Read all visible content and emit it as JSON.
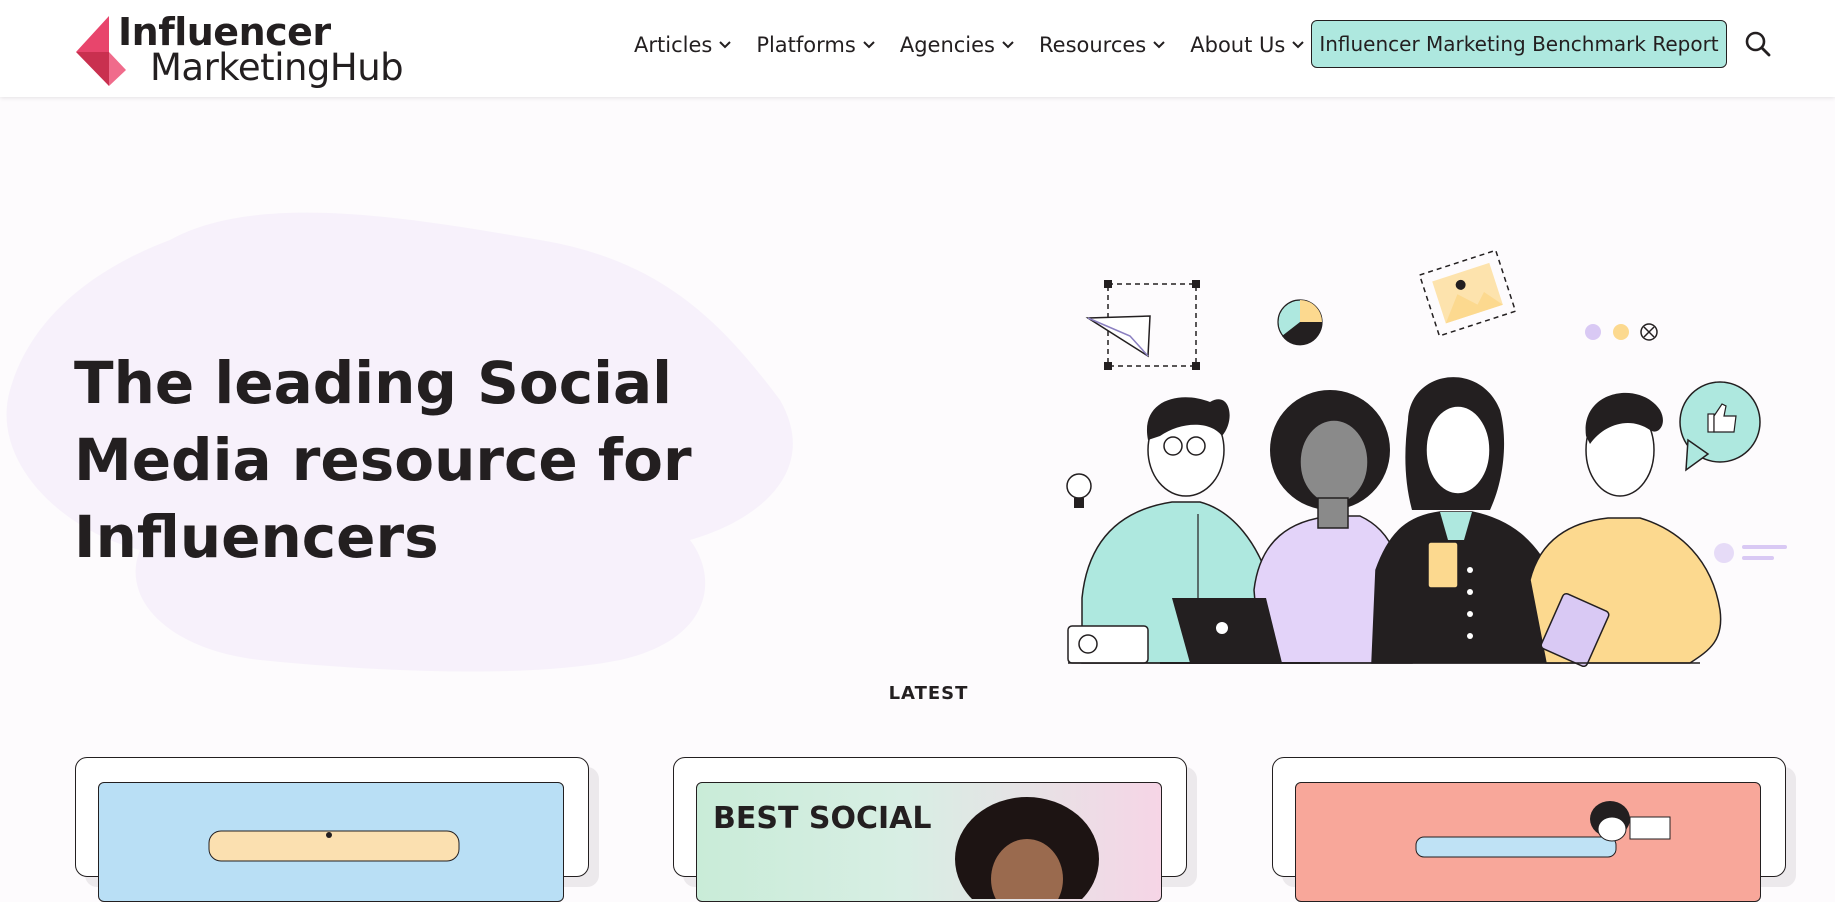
{
  "brand": {
    "name_line1": "Influencer",
    "name_line2": "MarketingHub",
    "colors": {
      "primary": "#e8456c",
      "accent": "#aee8df",
      "text": "#231f20"
    }
  },
  "nav": {
    "items": [
      {
        "label": "Articles",
        "icon": "chevron-down-icon"
      },
      {
        "label": "Platforms",
        "icon": "chevron-down-icon"
      },
      {
        "label": "Agencies",
        "icon": "chevron-down-icon"
      },
      {
        "label": "Resources",
        "icon": "chevron-down-icon"
      },
      {
        "label": "About Us",
        "icon": "chevron-down-icon"
      }
    ],
    "cta_label": "Influencer Marketing Benchmark Report",
    "search_icon": "search-icon"
  },
  "hero": {
    "title": "The leading Social Media resource for Influencers"
  },
  "latest": {
    "heading": "LATEST",
    "cards": [
      {
        "image_text": ""
      },
      {
        "image_text": "BEST SOCIAL"
      },
      {
        "image_text": ""
      }
    ]
  }
}
